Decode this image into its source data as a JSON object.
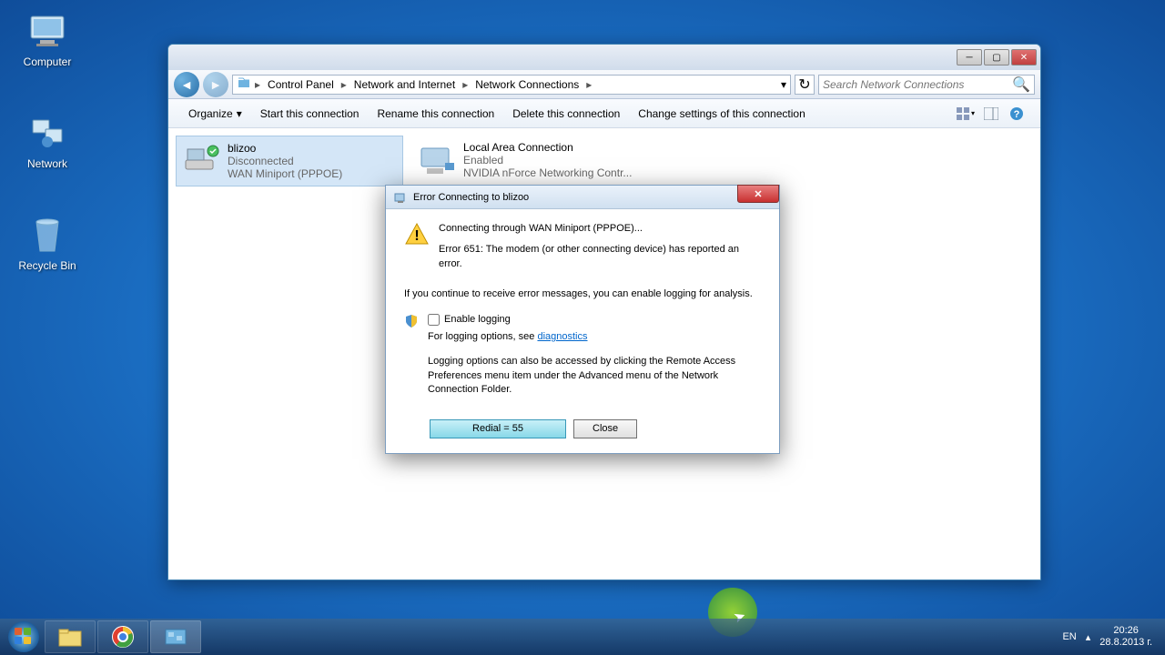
{
  "desktop": {
    "icons": [
      {
        "label": "Computer"
      },
      {
        "label": "Network"
      },
      {
        "label": "Recycle Bin"
      }
    ]
  },
  "window": {
    "breadcrumb": [
      "Control Panel",
      "Network and Internet",
      "Network Connections"
    ],
    "search_placeholder": "Search Network Connections",
    "toolbar": {
      "organize": "Organize",
      "start": "Start this connection",
      "rename": "Rename this connection",
      "delete": "Delete this connection",
      "change": "Change settings of this connection"
    },
    "connections": [
      {
        "name": "blizoo",
        "status": "Disconnected",
        "device": "WAN Miniport (PPPOE)",
        "selected": true
      },
      {
        "name": "Local Area Connection",
        "status": "Enabled",
        "device": "NVIDIA nForce Networking Contr...",
        "selected": false
      }
    ]
  },
  "dialog": {
    "title": "Error Connecting to blizoo",
    "connecting_msg": "Connecting through WAN Miniport (PPPOE)...",
    "error_msg": "Error 651: The modem (or other connecting device) has reported an error.",
    "continue_msg": "If you continue to receive error messages, you can enable logging for analysis.",
    "enable_logging": "Enable logging",
    "logging_options_prefix": "For logging options, see ",
    "diagnostics_link": "diagnostics",
    "logging_note": "Logging options can also be accessed by clicking the Remote Access Preferences menu item under the Advanced menu of the Network Connection Folder.",
    "redial": "Redial = 55",
    "close": "Close"
  },
  "taskbar": {
    "lang": "EN",
    "time": "20:26",
    "date": "28.8.2013 г."
  }
}
